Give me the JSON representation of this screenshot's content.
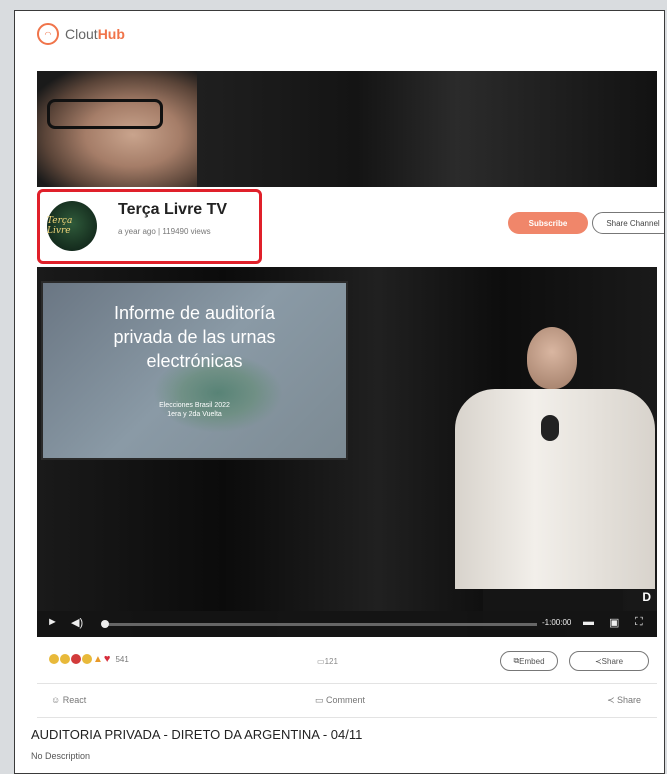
{
  "app": {
    "brand_prefix": "Clout",
    "brand_suffix": "Hub"
  },
  "channel": {
    "name": "Terça Livre TV",
    "meta": "a year ago | 119490 views",
    "avatar_text": "Terça Livre"
  },
  "buttons": {
    "subscribe": "Subscribe",
    "share_channel": "Share Channel",
    "embed": "Embed",
    "share": "Share"
  },
  "video": {
    "screen_title_lines": [
      "Informe de auditoría",
      "privada de las urnas",
      "electrónicas"
    ],
    "screen_sub_lines": [
      "Elecciones Brasil 2022",
      "1era y 2da Vuelta"
    ],
    "time_remaining": "-1:00:00",
    "watermark": "D",
    "progress": 0.0
  },
  "engagement": {
    "reaction_count": "541",
    "comment_count": "121"
  },
  "actions": {
    "react": "React",
    "comment": "Comment",
    "share": "Share"
  },
  "post": {
    "title": "AUDITORIA PRIVADA - DIRETO DA ARGENTINA - 04/11",
    "description": "No Description"
  },
  "colors": {
    "brand": "#f0744a",
    "subscribe": "#f0866a",
    "highlight": "#e0202a"
  },
  "icons": [
    "cloud-hub-logo-icon",
    "play-icon",
    "volume-icon",
    "settings-icon",
    "pip-icon",
    "fullscreen-icon",
    "embed-icon",
    "share-icon",
    "comment-icon",
    "react-icon"
  ]
}
